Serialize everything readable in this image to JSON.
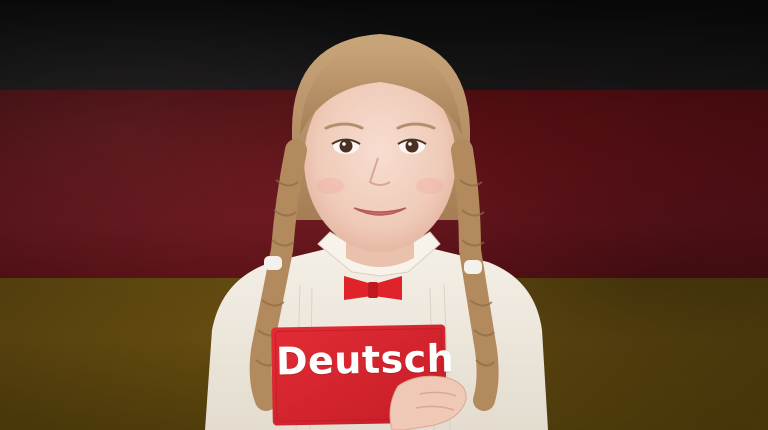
{
  "scene": {
    "description_colors": {
      "flag_black": "#111111",
      "flag_red": "#6b131a",
      "flag_gold": "#7a5c14",
      "book_red": "#d8242e",
      "bow_red": "#e0222a",
      "shirt": "#f1ece3",
      "hair": "#b8946a",
      "skin": "#f2d3c3"
    },
    "book": {
      "title": "Deutsch"
    }
  }
}
